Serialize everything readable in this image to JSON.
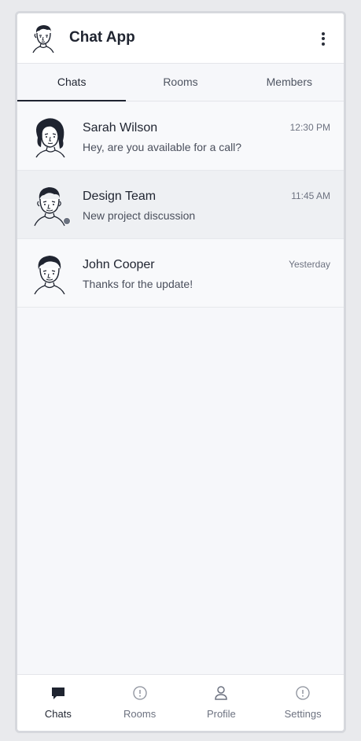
{
  "app": {
    "title": "Chat App",
    "logo_icon": "person-sketch-icon",
    "menu_icon": "more-vertical-icon"
  },
  "tabs": [
    {
      "label": "Chats",
      "active": true
    },
    {
      "label": "Rooms",
      "active": false
    },
    {
      "label": "Members",
      "active": false
    }
  ],
  "chats": [
    {
      "name": "Sarah Wilson",
      "message": "Hey, are you available for a call?",
      "time": "12:30 PM",
      "avatar": "woman-sketch-avatar",
      "selected": false
    },
    {
      "name": "Design Team",
      "message": "New project discussion",
      "time": "11:45 AM",
      "avatar": "man-sketch-avatar",
      "selected": true,
      "status": "offline"
    },
    {
      "name": "John Cooper",
      "message": "Thanks for the update!",
      "time": "Yesterday",
      "avatar": "man-sketch-avatar",
      "selected": false
    }
  ],
  "bottom_nav": [
    {
      "label": "Chats",
      "icon": "chat-bubble-icon",
      "active": true
    },
    {
      "label": "Rooms",
      "icon": "info-circle-icon",
      "active": false
    },
    {
      "label": "Profile",
      "icon": "user-icon",
      "active": false
    },
    {
      "label": "Settings",
      "icon": "info-circle-icon",
      "active": false
    }
  ],
  "colors": {
    "background": "#f6f7fa",
    "text": "#1f2430",
    "muted": "#6d7280",
    "status_dot": "#6b7280"
  }
}
